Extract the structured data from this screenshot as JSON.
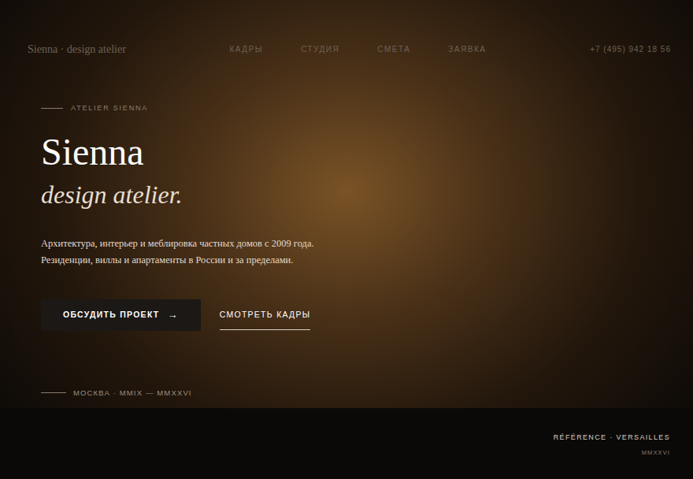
{
  "brand": "Sienna · design atelier",
  "nav": {
    "items": [
      "КАДРЫ",
      "СТУДИЯ",
      "СМЕТА",
      "ЗАЯВКА"
    ],
    "phone": "+7 (495) 942 18 56"
  },
  "hero": {
    "eyebrow": "ATELIER SIENNA",
    "title": "Sienna",
    "subtitle": "design atelier.",
    "description": [
      "Архитектура, интерьер и меблировка частных домов с 2009 года.",
      "Резиденции, виллы и апартаменты в России и за пределами."
    ],
    "primary_button": {
      "label": "ОБСУДИТЬ ПРОЕКТ",
      "icon": "→"
    },
    "secondary_link": "СМОТРЕТЬ КАДРЫ",
    "location": "МОСКВА · MMIX — MMXXVI"
  },
  "caption": {
    "title": "RÉFÉRENCE · VERSAILLES",
    "year": "MMXXVI"
  }
}
